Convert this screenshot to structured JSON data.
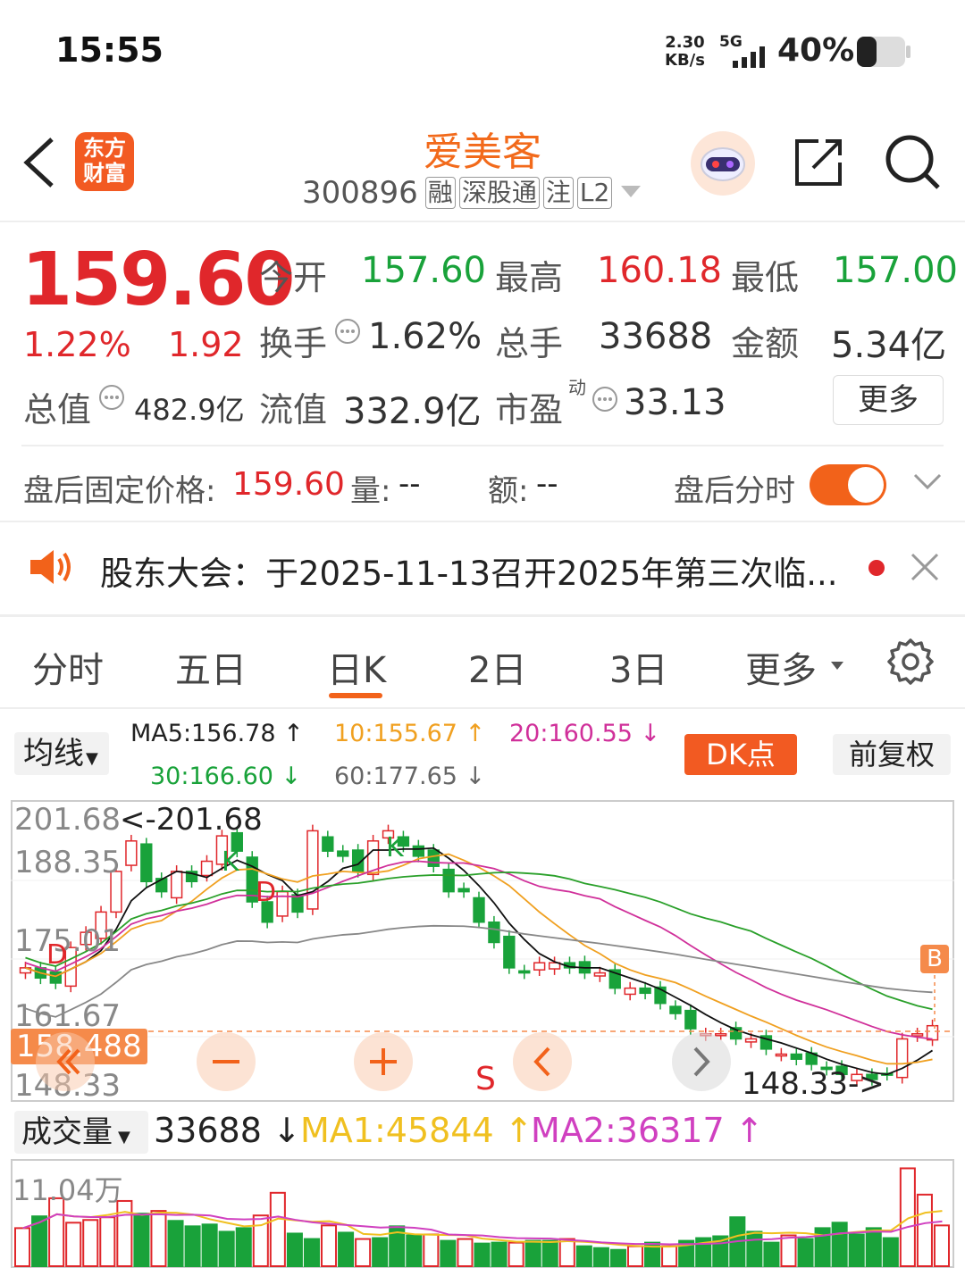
{
  "status_bar": {
    "time": "15:55",
    "net_speed_top": "2.30",
    "net_speed_bottom": "KB/s",
    "network": "5G",
    "battery": "40%"
  },
  "header": {
    "title": "爱美客",
    "code": "300896",
    "badges": [
      "融",
      "深股通",
      "注",
      "L2"
    ],
    "app_logo_line1": "东方",
    "app_logo_line2": "财富"
  },
  "quote": {
    "price": "159.60",
    "change_pct": "1.22%",
    "change": "1.92",
    "open_label": "今开",
    "open": "157.60",
    "high_label": "最高",
    "high": "160.18",
    "low_label": "最低",
    "low": "157.00",
    "turnover_label": "换手",
    "turnover": "1.62%",
    "volume_label": "总手",
    "volume": "33688",
    "amount_label": "金额",
    "amount": "5.34亿",
    "mktcap_label": "总值",
    "mktcap": "482.9亿",
    "float_label": "流值",
    "float": "332.9亿",
    "pe_label": "市盈",
    "pe_sup": "动",
    "pe": "33.13",
    "more": "更多"
  },
  "after_hours": {
    "label": "盘后固定价格:",
    "price": "159.60",
    "vol_label": "量:",
    "vol": "--",
    "amt_label": "额:",
    "amt": "--",
    "toggle_label": "盘后分时"
  },
  "notice": {
    "text": "股东大会：于2025-11-13召开2025年第三次临..."
  },
  "tabs": [
    "分时",
    "五日",
    "日K",
    "2日",
    "3日",
    "更多"
  ],
  "active_tab": "日K",
  "ma_bar": {
    "selector": "均线",
    "ma5": "MA5:156.78 ↑",
    "ma10": "10:155.67 ↑",
    "ma20": "20:160.55 ↓",
    "ma30": "30:166.60 ↓",
    "ma60": "60:177.65 ↓",
    "dk": "DK点",
    "adjust": "前复权"
  },
  "colors": {
    "up": "#e0272b",
    "down": "#19a23a",
    "accent": "#f26a1b",
    "ma5": "#111111",
    "ma10": "#f0a020",
    "ma20": "#d0309a",
    "ma30": "#2aa02a",
    "ma60": "#888888"
  },
  "chart_data": {
    "type": "candlestick",
    "price_labels": [
      "201.68",
      "188.35",
      "175.01",
      "161.67",
      "148.33"
    ],
    "max_note": "<-201.68",
    "min_note": "148.33->",
    "cursor_price": "158.488",
    "marks": [
      "K",
      "D",
      "K",
      "D",
      "K",
      "S",
      "B"
    ],
    "closes": [
      171,
      169,
      168,
      175,
      178,
      182,
      190,
      196,
      188,
      186,
      190,
      188,
      192,
      197,
      194,
      184,
      180,
      186,
      182,
      198,
      194,
      193,
      190,
      196,
      198,
      195,
      193,
      191,
      186,
      186,
      180,
      176,
      171,
      170,
      172,
      172,
      171,
      170,
      170,
      167,
      167,
      166,
      164,
      162,
      159,
      158,
      158,
      157,
      157,
      155,
      154,
      153,
      152,
      151,
      150,
      150,
      149,
      150,
      157,
      158,
      159.6
    ]
  },
  "volume": {
    "label": "成交量",
    "value": "33688 ↓",
    "ma1": "MA1:45844 ↑",
    "ma2": "MA2:36317 ↑",
    "max_label": "11.04万",
    "bars": [
      4.2,
      5.5,
      7.5,
      4.8,
      5.1,
      5.4,
      7.2,
      5.8,
      6.1,
      5.0,
      4.4,
      4.6,
      3.8,
      4.2,
      5.6,
      8.1,
      3.6,
      3.0,
      4.5,
      3.7,
      3.0,
      3.1,
      4.4,
      3.4,
      3.5,
      2.8,
      3.0,
      2.5,
      2.6,
      2.6,
      2.8,
      2.8,
      3.0,
      2.2,
      2.0,
      1.8,
      2.2,
      2.6,
      2.2,
      2.8,
      3.1,
      3.3,
      5.4,
      3.8,
      2.6,
      3.4,
      3.0,
      4.2,
      4.8,
      3.5,
      4.2,
      3.1,
      10.8,
      7.9,
      4.5
    ],
    "up": [
      1,
      0,
      1,
      1,
      1,
      1,
      1,
      0,
      1,
      0,
      0,
      0,
      0,
      0,
      1,
      1,
      0,
      0,
      1,
      0,
      1,
      0,
      0,
      0,
      1,
      0,
      1,
      0,
      0,
      1,
      0,
      0,
      1,
      0,
      0,
      0,
      1,
      0,
      1,
      0,
      0,
      0,
      0,
      0,
      0,
      1,
      0,
      0,
      0,
      0,
      0,
      0,
      1,
      1,
      1
    ]
  }
}
